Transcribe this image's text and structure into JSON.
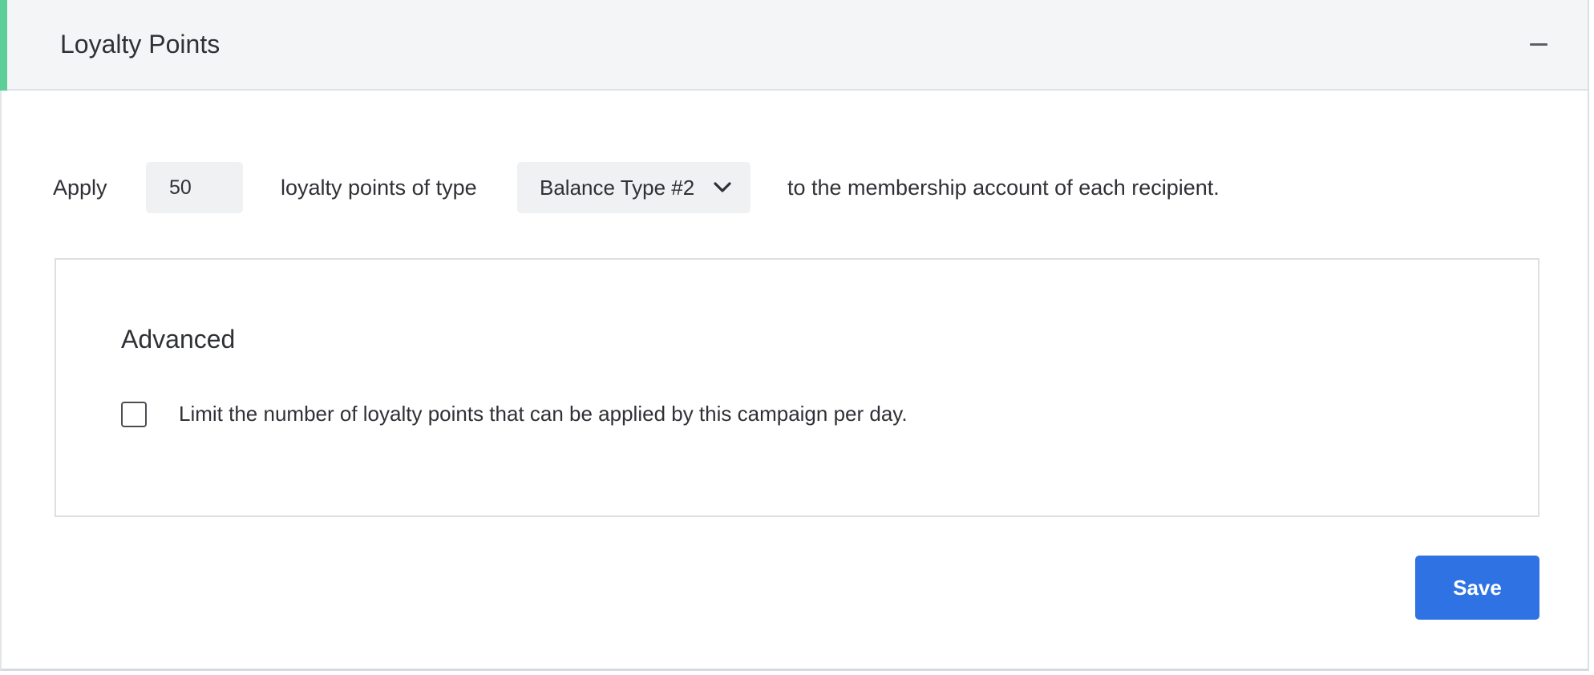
{
  "panel": {
    "title": "Loyalty Points",
    "collapse_icon": "minus-icon",
    "accent_color": "#5ccf98"
  },
  "rule": {
    "prefix": "Apply",
    "points_value": "50",
    "middle_text": "loyalty points of type",
    "balance_type_selected": "Balance Type #2",
    "dropdown_icon": "chevron-down-icon",
    "suffix": "to the membership account of each recipient."
  },
  "advanced": {
    "title": "Advanced",
    "limit_checkbox_label": "Limit the number of loyalty points that can be applied by this campaign per day.",
    "limit_checked": false
  },
  "actions": {
    "save_label": "Save",
    "save_color": "#2f72e4"
  }
}
